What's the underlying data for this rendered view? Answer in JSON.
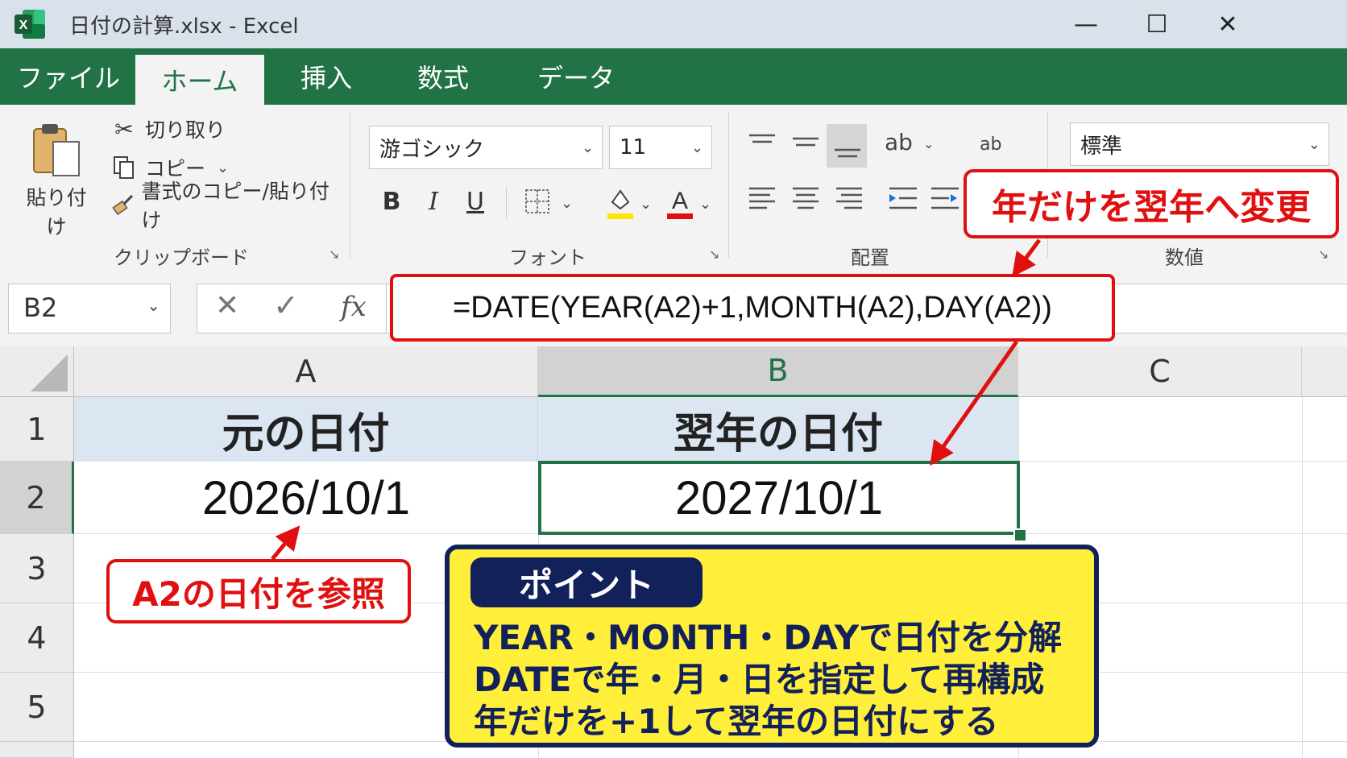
{
  "window": {
    "title": "日付の計算.xlsx - Excel",
    "app_icon": "excel-logo",
    "controls": {
      "minimize": "—",
      "maximize": "☐",
      "close": "✕"
    }
  },
  "ribbon": {
    "tabs": [
      "ファイル",
      "ホーム",
      "挿入",
      "数式",
      "データ"
    ],
    "active_tab": "ホーム",
    "clipboard": {
      "paste_label": "貼り付け",
      "cut_label": "切り取り",
      "copy_label": "コピー",
      "format_painter_label": "書式のコピー/貼り付け",
      "group_label": "クリップボード"
    },
    "font": {
      "font_name": "游ゴシック",
      "font_size": "11",
      "bold": "B",
      "italic": "I",
      "underline": "U",
      "group_label": "フォント"
    },
    "alignment": {
      "group_label": "配置"
    },
    "number": {
      "format": "標準",
      "group_label": "数値"
    }
  },
  "formula_bar": {
    "name_box": "B2",
    "fx_label": "fx",
    "formula": "=DATE(YEAR(A2)+1,MONTH(A2),DAY(A2))"
  },
  "sheet": {
    "columns": [
      "A",
      "B",
      "C"
    ],
    "rows": [
      "1",
      "2",
      "3",
      "4",
      "5"
    ],
    "selected_cell": "B2",
    "cells": {
      "A1": "元の日付",
      "B1": "翌年の日付",
      "A2": "2026/10/1",
      "B2": "2027/10/1"
    }
  },
  "annotations": {
    "year_change_callout": "年だけを翌年へ変更",
    "reference_callout": "A2の日付を参照",
    "point_title": "ポイント",
    "point_lines": [
      "YEAR・MONTH・DAYで日付を分解",
      "DATEで年・月・日を指定して再構成",
      "年だけを+1して翌年の日付にする"
    ]
  },
  "colors": {
    "excel_green": "#217346",
    "callout_red": "#e01010",
    "point_yellow": "#ffee3a",
    "point_navy": "#12215a",
    "header_fill": "#dce6f2"
  }
}
